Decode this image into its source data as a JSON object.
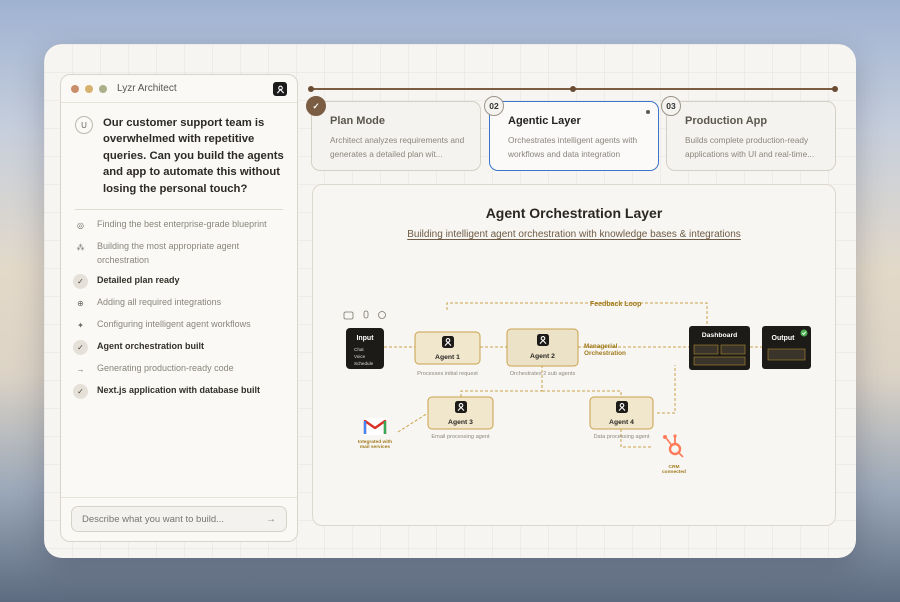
{
  "window": {
    "app_title": "Lyzr Architect",
    "traffic_colors": [
      "#c98f6c",
      "#d9b16e",
      "#a9b08a"
    ]
  },
  "chat": {
    "user_avatar": "U",
    "user_message": "Our customer support team is overwhelmed with repetitive queries. Can you build the agents and app to automate this without losing the personal touch?",
    "steps": [
      {
        "icon": "target-icon",
        "glyph": "◎",
        "text": "Finding the best enterprise-grade blueprint",
        "done": false
      },
      {
        "icon": "network-icon",
        "glyph": "⁂",
        "text": "Building the most appropriate agent orchestration",
        "done": false
      },
      {
        "icon": "check-icon",
        "glyph": "✓",
        "text": "Detailed plan ready",
        "done": true
      },
      {
        "icon": "globe-icon",
        "glyph": "⊕",
        "text": "Adding all required integrations",
        "done": false
      },
      {
        "icon": "sparkle-icon",
        "glyph": "✦",
        "text": "Configuring intelligent agent workflows",
        "done": false
      },
      {
        "icon": "check-icon",
        "glyph": "✓",
        "text": "Agent orchestration built",
        "done": true
      },
      {
        "icon": "arrow-right-icon",
        "glyph": "→",
        "text": "Generating production-ready code",
        "done": false
      },
      {
        "icon": "check-icon",
        "glyph": "✓",
        "text": "Next.js application with database built",
        "done": true
      }
    ],
    "input_placeholder": "Describe what you want to build...",
    "send_glyph": "→"
  },
  "stages": [
    {
      "badge": "✓",
      "title": "Plan Mode",
      "desc": "Architect analyzes requirements and generates a detailed plan wit...",
      "state": "done"
    },
    {
      "badge": "02",
      "title": "Agentic Layer",
      "desc": "Orchestrates intelligent agents with workflows and data integration",
      "state": "active"
    },
    {
      "badge": "03",
      "title": "Production App",
      "desc": "Builds complete production-ready applications with UI and real-time...",
      "state": "pending"
    }
  ],
  "orchestration": {
    "title": "Agent Orchestration Layer",
    "subtitle": "Building intelligent agent orchestration with knowledge bases & integrations",
    "feedback_loop": "Feedback Loop",
    "input": {
      "label": "Input",
      "items": [
        "Chat",
        "Voice",
        "Schedule"
      ]
    },
    "agent1": {
      "label": "Agent 1",
      "caption": "Processes initial request"
    },
    "agent2": {
      "label": "Agent 2",
      "caption": "Orchestrates 2 sub agents"
    },
    "managerial": [
      "Managerial",
      "Orchestration"
    ],
    "agent3": {
      "label": "Agent 3",
      "caption": "Email processing agent"
    },
    "agent4": {
      "label": "Agent 4",
      "caption": "Data processing agent"
    },
    "dashboard": "Dashboard",
    "output": "Output",
    "gmail_caption": [
      "Integrated with",
      "mail services"
    ],
    "crm_caption": [
      "CRM",
      "connected"
    ],
    "accent": "#b08a2e",
    "agent_fill": "#f1e7cd"
  }
}
